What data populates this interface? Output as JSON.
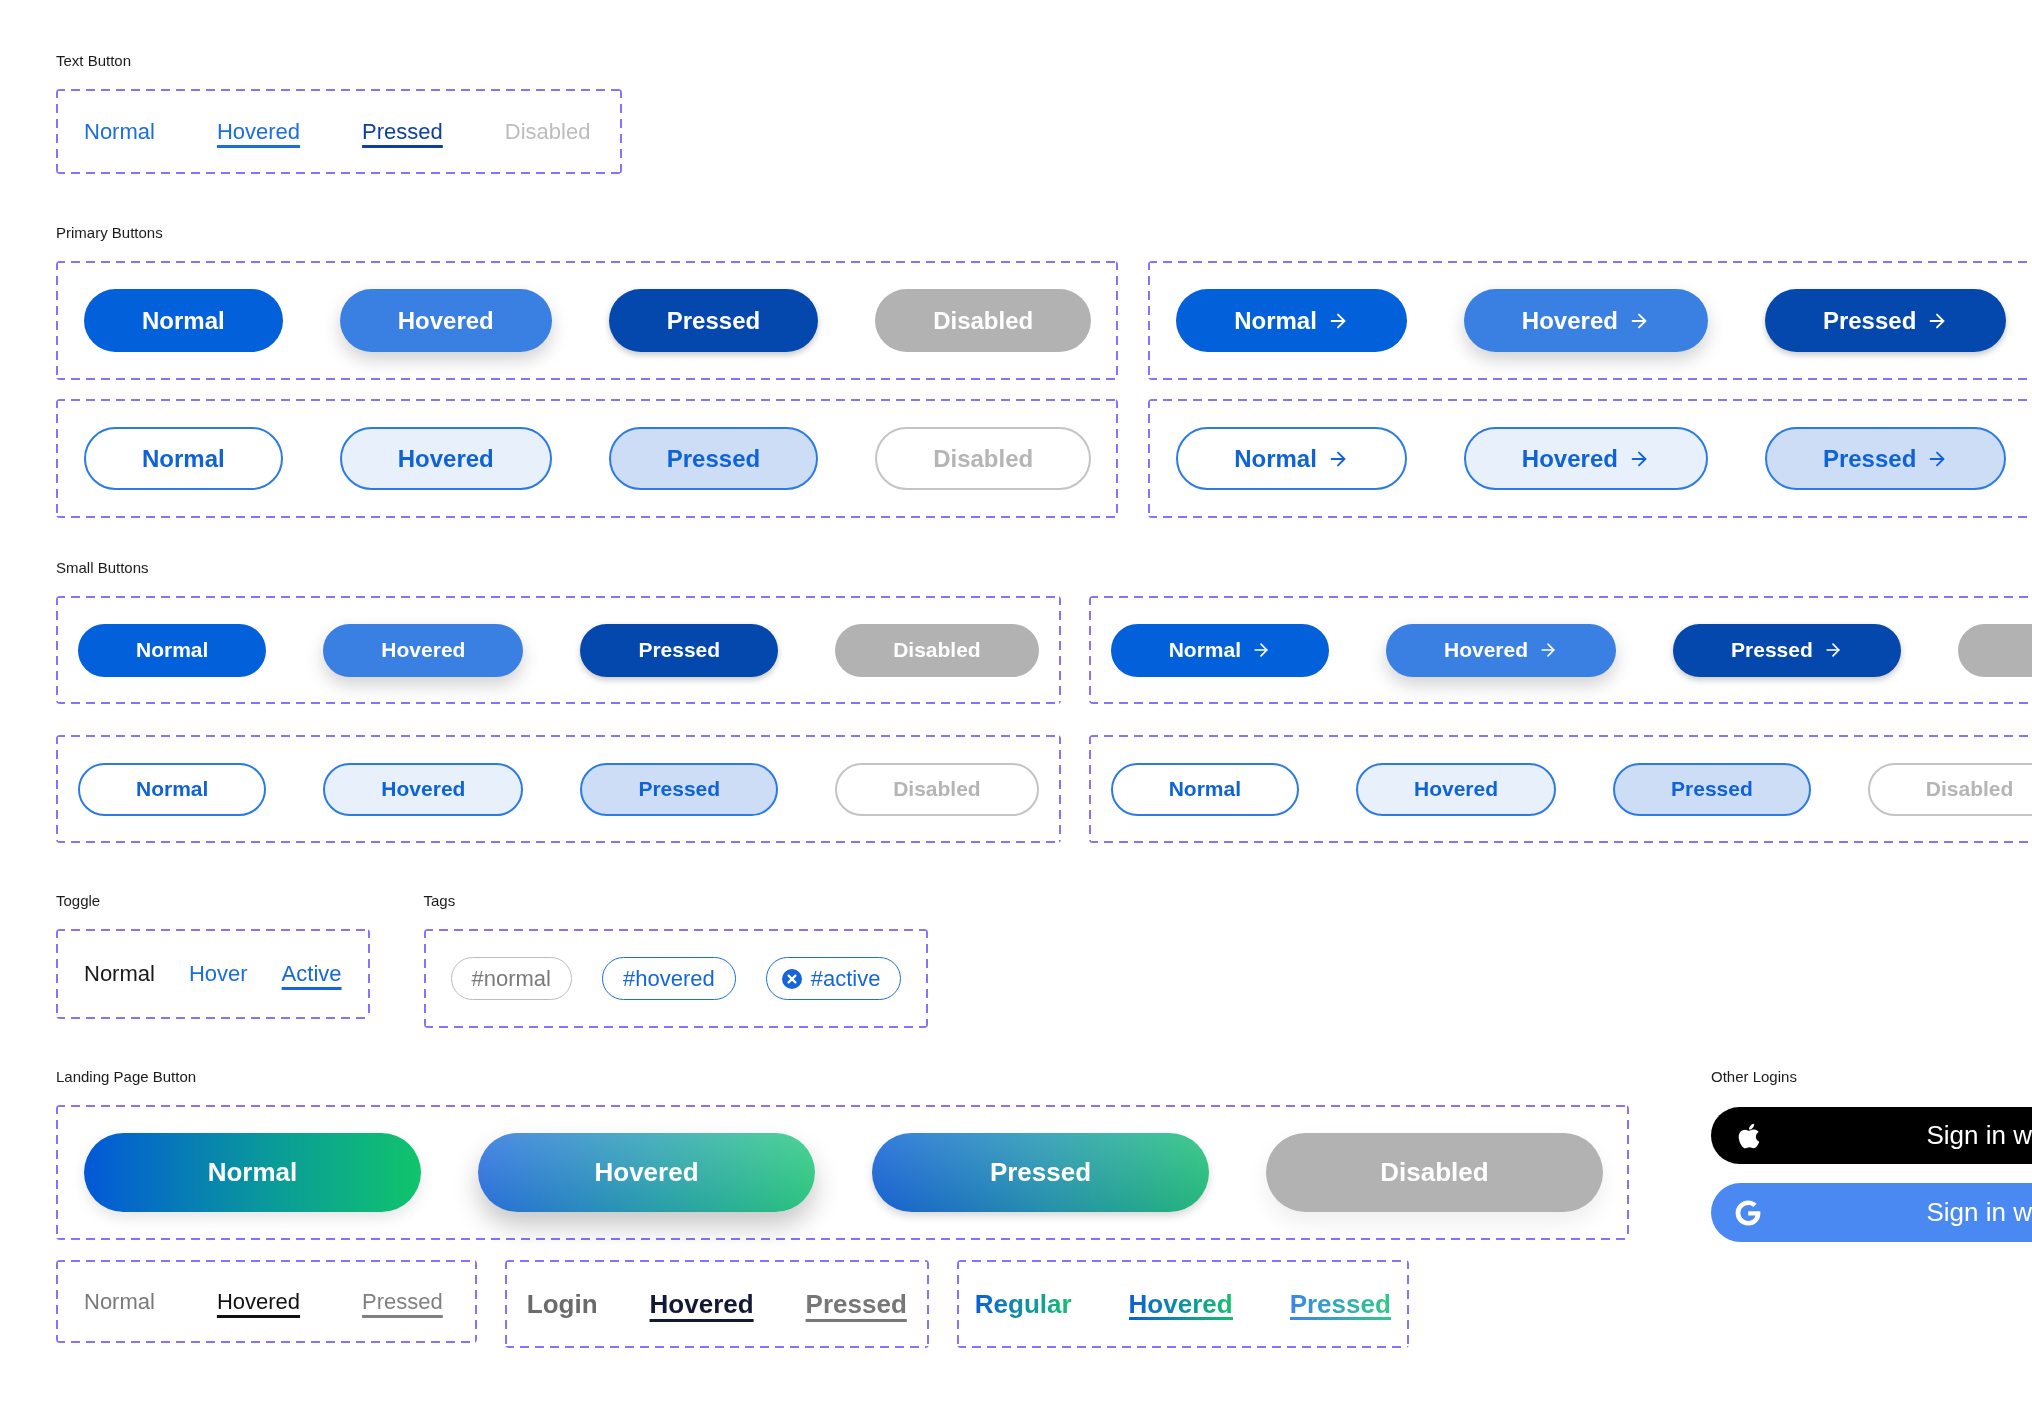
{
  "text_button": {
    "title": "Text Button",
    "buttons": [
      {
        "label": "Normal",
        "kind": "normal"
      },
      {
        "label": "Hovered",
        "kind": "hovered"
      },
      {
        "label": "Pressed",
        "kind": "pressed"
      },
      {
        "label": "Disabled",
        "kind": "disabled"
      }
    ]
  },
  "primary_buttons": {
    "title": "Primary Buttons",
    "rows": [
      {
        "kind": "filled",
        "groups": [
          {
            "arrow": false,
            "buttons": [
              {
                "label": "Normal",
                "kind": "normal"
              },
              {
                "label": "Hovered",
                "kind": "hovered"
              },
              {
                "label": "Pressed",
                "kind": "pressed"
              },
              {
                "label": "Disabled",
                "kind": "disabled"
              }
            ]
          },
          {
            "arrow": true,
            "buttons": [
              {
                "label": "Normal",
                "kind": "normal"
              },
              {
                "label": "Hovered",
                "kind": "hovered"
              },
              {
                "label": "Pressed",
                "kind": "pressed"
              }
            ]
          }
        ]
      },
      {
        "kind": "outline",
        "groups": [
          {
            "arrow": false,
            "buttons": [
              {
                "label": "Normal",
                "kind": "normal"
              },
              {
                "label": "Hovered",
                "kind": "hovered"
              },
              {
                "label": "Pressed",
                "kind": "pressed"
              },
              {
                "label": "Disabled",
                "kind": "disabled"
              }
            ]
          },
          {
            "arrow": true,
            "buttons": [
              {
                "label": "Normal",
                "kind": "normal"
              },
              {
                "label": "Hovered",
                "kind": "hovered"
              },
              {
                "label": "Pressed",
                "kind": "pressed"
              }
            ]
          }
        ]
      }
    ]
  },
  "small_buttons": {
    "title": "Small Buttons",
    "rows": [
      {
        "kind": "filled",
        "groups": [
          {
            "arrow": false,
            "buttons": [
              {
                "label": "Normal",
                "kind": "normal"
              },
              {
                "label": "Hovered",
                "kind": "hovered"
              },
              {
                "label": "Pressed",
                "kind": "pressed"
              },
              {
                "label": "Disabled",
                "kind": "disabled"
              }
            ]
          },
          {
            "arrow": true,
            "buttons": [
              {
                "label": "Normal",
                "kind": "normal"
              },
              {
                "label": "Hovered",
                "kind": "hovered"
              },
              {
                "label": "Pressed",
                "kind": "pressed"
              },
              {
                "kind": "disabled"
              }
            ]
          }
        ]
      },
      {
        "kind": "outline",
        "groups": [
          {
            "arrow": false,
            "buttons": [
              {
                "label": "Normal",
                "kind": "normal"
              },
              {
                "label": "Hovered",
                "kind": "hovered"
              },
              {
                "label": "Pressed",
                "kind": "pressed"
              },
              {
                "label": "Disabled",
                "kind": "disabled"
              }
            ]
          },
          {
            "arrow": false,
            "buttons": [
              {
                "label": "Normal",
                "kind": "normal"
              },
              {
                "label": "Hovered",
                "kind": "hovered"
              },
              {
                "label": "Pressed",
                "kind": "pressed"
              },
              {
                "label": "Disabled",
                "kind": "disabled"
              }
            ]
          }
        ]
      }
    ]
  },
  "toggle": {
    "title": "Toggle",
    "items": [
      {
        "label": "Normal",
        "kind": "normal"
      },
      {
        "label": "Hover",
        "kind": "hovered"
      },
      {
        "label": "Active",
        "kind": "active"
      }
    ]
  },
  "tags": {
    "title": "Tags",
    "items": [
      {
        "label": "#normal",
        "kind": "normal"
      },
      {
        "label": "#hovered",
        "kind": "hovered"
      },
      {
        "label": "#active",
        "kind": "active"
      }
    ]
  },
  "landing_page_button": {
    "title": "Landing Page Button",
    "buttons": [
      {
        "label": "Normal",
        "kind": "normal"
      },
      {
        "label": "Hovered",
        "kind": "hovered"
      },
      {
        "label": "Pressed",
        "kind": "pressed"
      },
      {
        "label": "Disabled",
        "kind": "disabled"
      }
    ],
    "link_groups": [
      {
        "kind": "plain",
        "links": [
          {
            "label": "Normal",
            "kind": "normal"
          },
          {
            "label": "Hovered",
            "kind": "hovered"
          },
          {
            "label": "Pressed",
            "kind": "pressed"
          }
        ]
      },
      {
        "kind": "bold",
        "links": [
          {
            "label": "Login",
            "kind": "normal"
          },
          {
            "label": "Hovered",
            "kind": "hovered"
          },
          {
            "label": "Pressed",
            "kind": "pressed"
          }
        ]
      },
      {
        "kind": "gradient",
        "links": [
          {
            "label": "Regular",
            "kind": "normal"
          },
          {
            "label": "Hovered",
            "kind": "hovered"
          },
          {
            "label": "Pressed",
            "kind": "pressed"
          }
        ]
      }
    ]
  },
  "other_logins": {
    "title": "Other Logins",
    "buttons": [
      {
        "kind": "apple",
        "label": "Sign in w"
      },
      {
        "kind": "google",
        "label": "Sign in w"
      }
    ]
  }
}
